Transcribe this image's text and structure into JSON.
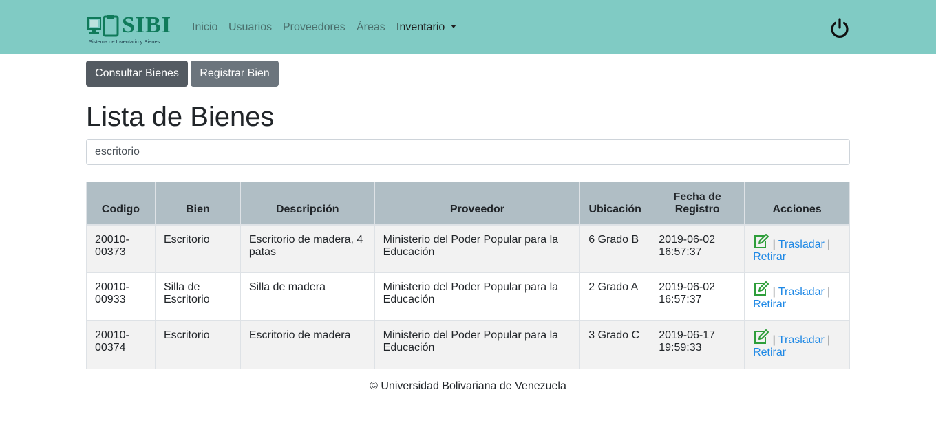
{
  "brand": {
    "name": "SIBI",
    "tagline": "Sistema de Inventario y Bienes"
  },
  "nav": {
    "items": [
      "Inicio",
      "Usuarios",
      "Proveedores",
      "Áreas"
    ],
    "active_dropdown": "Inventario"
  },
  "actions": {
    "consult": "Consultar Bienes",
    "register": "Registrar Bien"
  },
  "page_title": "Lista de Bienes",
  "search": {
    "value": "escritorio"
  },
  "table": {
    "headers": [
      "Codigo",
      "Bien",
      "Descripción",
      "Proveedor",
      "Ubicación",
      "Fecha de Registro",
      "Acciones"
    ],
    "rows": [
      {
        "codigo": "20010-00373",
        "bien": "Escritorio",
        "descripcion": "Escritorio de madera, 4 patas",
        "proveedor": "Ministerio del Poder Popular para la Educación",
        "ubicacion": "6 Grado B",
        "fecha": "2019-06-02 16:57:37"
      },
      {
        "codigo": "20010-00933",
        "bien": "Silla de Escritorio",
        "descripcion": "Silla de madera",
        "proveedor": "Ministerio del Poder Popular para la Educación",
        "ubicacion": "2 Grado A",
        "fecha": "2019-06-02 16:57:37"
      },
      {
        "codigo": "20010-00374",
        "bien": "Escritorio",
        "descripcion": "Escritorio de madera",
        "proveedor": "Ministerio del Poder Popular para la Educación",
        "ubicacion": "3 Grado C",
        "fecha": "2019-06-17 19:59:33"
      }
    ],
    "action_labels": {
      "separator": "|",
      "move": "Trasladar",
      "retire": "Retirar"
    }
  },
  "footer": "© Universidad Bolivariana de Venezuela",
  "colors": {
    "navbar": "#80cbc4",
    "brand": "#0f7a5a",
    "header_row": "#b0bec5",
    "link": "#1e88e5",
    "edit_icon": "#2e9e3a"
  },
  "icons": {
    "logo": "clipboard-monitor-logo",
    "power": "power-icon",
    "edit": "edit-icon"
  }
}
